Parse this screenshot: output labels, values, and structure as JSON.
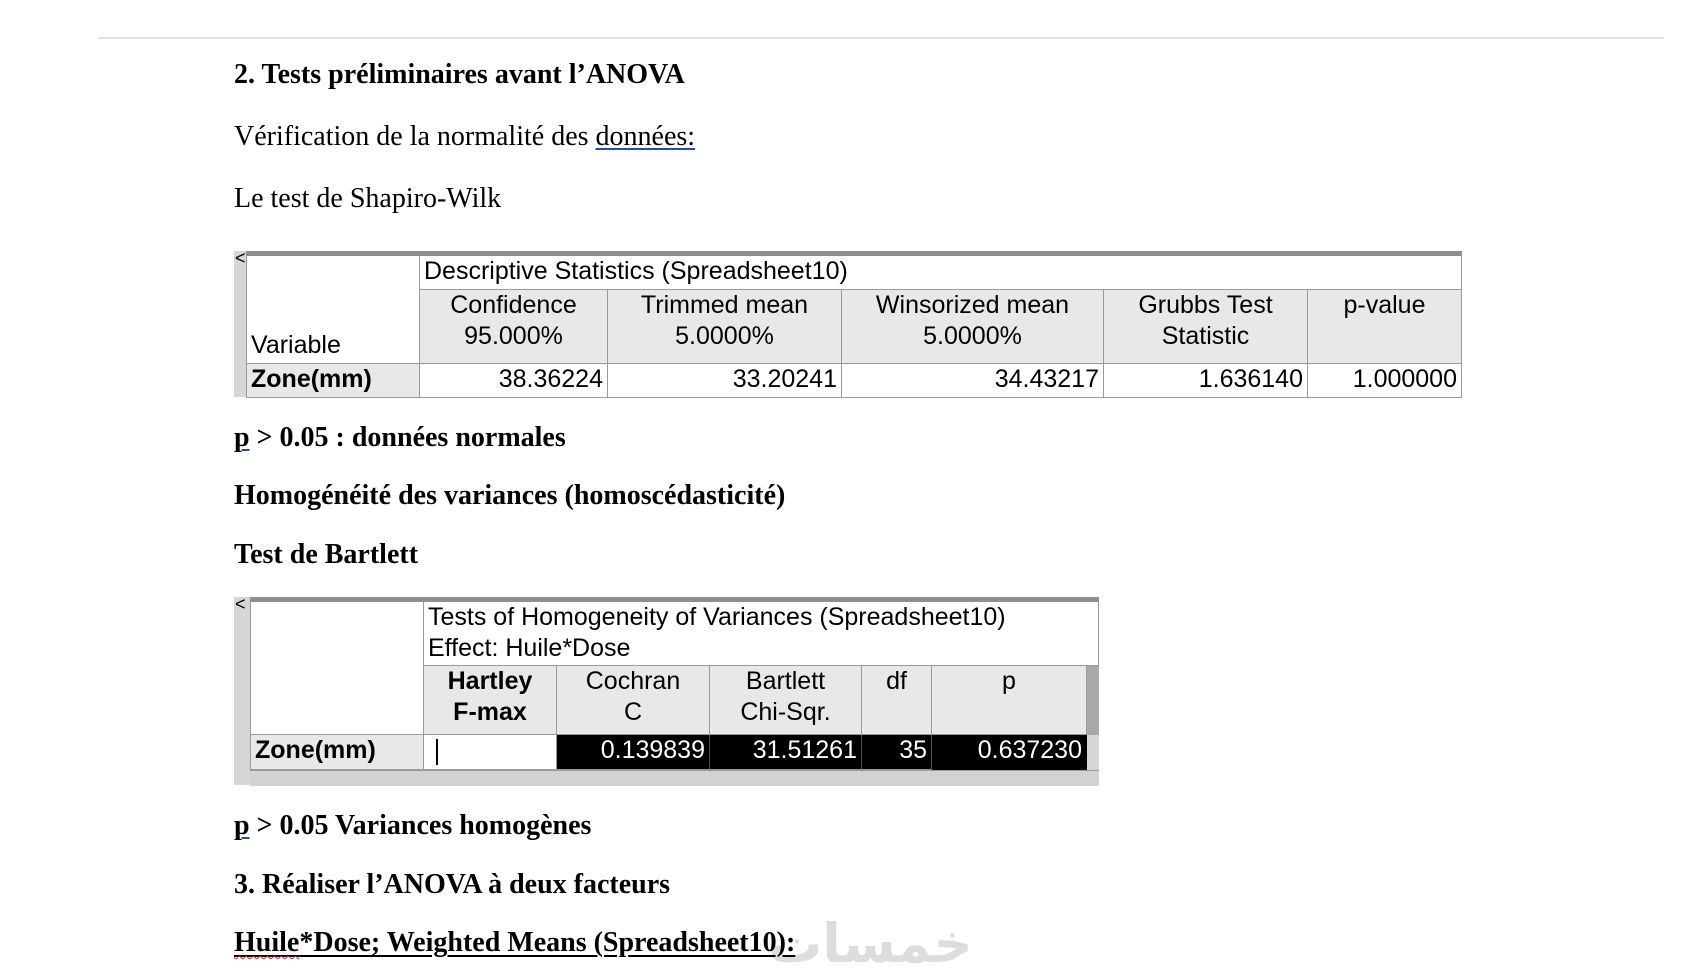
{
  "document": {
    "section2_heading": "2. Tests préliminaires avant l’ANOVA",
    "normality_prefix": "Vérification de la normalité des ",
    "normality_link": "données:",
    "shapiro_line": "Le test de Shapiro-Wilk",
    "p_normal_p": "p",
    "p_normal_rest": " > 0.05 : données normales",
    "homogeneity_heading": "Homogénéité des variances (homoscédasticité)",
    "bartlett_heading": "Test de Bartlett",
    "p_homog_p": "p",
    "p_homog_rest": " > 0.05 Variances homogènes",
    "section3_heading": "3. Réaliser l’ANOVA à deux facteurs",
    "weighted_means_first": "Huile",
    "weighted_means_rest": "*Dose; Weighted Means (Spreadsheet10):",
    "watermark": "خمسات"
  },
  "descriptive_table": {
    "collapse_glyph": "<",
    "title": "Descriptive Statistics (Spreadsheet10)",
    "variable_header": "Variable",
    "columns": [
      {
        "line1": "Confidence",
        "line2": "95.000%"
      },
      {
        "line1": "Trimmed mean",
        "line2": "5.0000%"
      },
      {
        "line1": "Winsorized mean",
        "line2": "5.0000%"
      },
      {
        "line1": "Grubbs Test",
        "line2": "Statistic"
      },
      {
        "line1": "p-value",
        "line2": ""
      }
    ],
    "row_label": "Zone(mm)",
    "values": [
      "38.36224",
      "33.20241",
      "34.43217",
      "1.636140",
      "1.000000"
    ]
  },
  "homogeneity_table": {
    "collapse_glyph": "<",
    "title_line1": "Tests of Homogeneity of Variances (Spreadsheet10)",
    "title_line2": "Effect: Huile*Dose",
    "columns": [
      {
        "line1": "Hartley",
        "line2": "F-max"
      },
      {
        "line1": "Cochran",
        "line2": "C"
      },
      {
        "line1": "Bartlett",
        "line2": "Chi-Sqr."
      },
      {
        "line1": "df",
        "line2": ""
      },
      {
        "line1": "p",
        "line2": ""
      }
    ],
    "row_label": "Zone(mm)",
    "values": [
      "",
      "0.139839",
      "31.51261",
      "35",
      "0.637230"
    ]
  }
}
